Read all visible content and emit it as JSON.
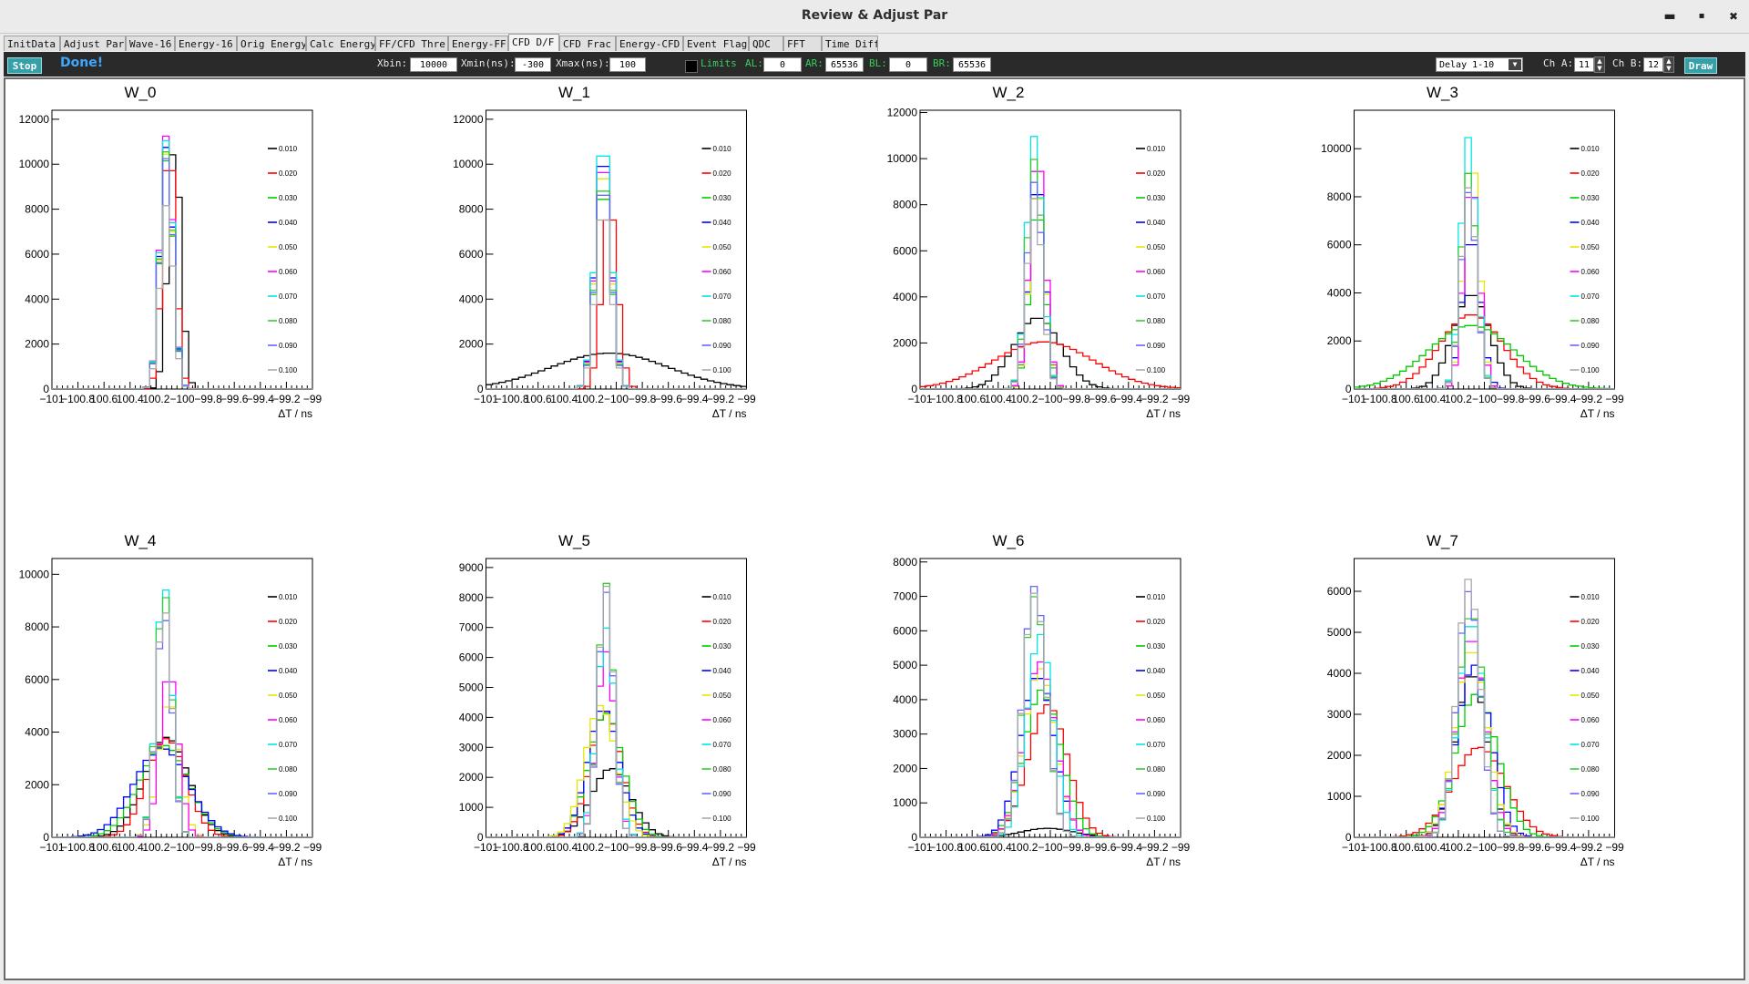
{
  "window": {
    "title": "Review & Adjust Par",
    "minimize": "▬",
    "maximize": "▪",
    "close": "✖"
  },
  "tabs": [
    {
      "label": "InitData",
      "active": false
    },
    {
      "label": "Adjust Par",
      "active": false
    },
    {
      "label": "Wave-16",
      "active": false
    },
    {
      "label": "Energy-16",
      "active": false
    },
    {
      "label": "Orig Energy",
      "active": false
    },
    {
      "label": "Calc Energy",
      "active": false
    },
    {
      "label": "FF/CFD Thre",
      "active": false
    },
    {
      "label": "Energy-FF",
      "active": false
    },
    {
      "label": "CFD D/F",
      "active": true
    },
    {
      "label": "CFD Frac",
      "active": false
    },
    {
      "label": "Energy-CFD",
      "active": false
    },
    {
      "label": "Event Flag",
      "active": false
    },
    {
      "label": "QDC",
      "active": false
    },
    {
      "label": "FFT",
      "active": false
    },
    {
      "label": "Time Diff",
      "active": false
    }
  ],
  "toolbar": {
    "stop_label": "Stop",
    "status": "Done!",
    "xbin_label": "Xbin:",
    "xbin_value": "10000",
    "xmin_label": "Xmin(ns):",
    "xmin_value": "-300",
    "xmax_label": "Xmax(ns):",
    "xmax_value": "100",
    "limits_label": "Limits",
    "al_label": "AL:",
    "al_value": "0",
    "ar_label": "AR:",
    "ar_value": "65536",
    "bl_label": "BL:",
    "bl_value": "0",
    "br_label": "BR:",
    "br_value": "65536",
    "delay_value": "Delay 1-10",
    "cha_label": "Ch A:",
    "cha_value": "11",
    "chb_label": "Ch B:",
    "chb_value": "12",
    "draw_label": "Draw"
  },
  "chart_data": {
    "type": "histogram",
    "xlabel": "ΔT / ns",
    "x_ticks": [
      "−101",
      "−100.8",
      "100.6",
      "100.4",
      "100.2",
      "−100",
      "−99.8",
      "−99.6",
      "−99.4",
      "−99.2",
      "−99"
    ],
    "xlim": [
      -101,
      -99
    ],
    "legend_labels": [
      "0.010",
      "0.020",
      "0.030",
      "0.040",
      "0.050",
      "0.060",
      "0.070",
      "0.080",
      "0.090",
      "0.100"
    ],
    "series_colors": [
      "#000000",
      "#ff0000",
      "#00cc00",
      "#0000ff",
      "#e6e600",
      "#ff00ff",
      "#00e6e6",
      "#33cc33",
      "#6666ff",
      "#aaaaaa"
    ],
    "panels": [
      {
        "title": "W_0",
        "ylim": [
          0,
          12400
        ],
        "yticks": [
          0,
          2000,
          4000,
          6000,
          8000,
          10000,
          12000
        ],
        "series": [
          {
            "peak": 10900,
            "center": -100.06,
            "sigma": 0.05
          },
          {
            "peak": 11000,
            "center": -100.1,
            "sigma": 0.05
          },
          {
            "peak": 10200,
            "center": -100.12,
            "sigma": 0.05
          },
          {
            "peak": 10800,
            "center": -100.12,
            "sigma": 0.05
          },
          {
            "peak": 10500,
            "center": -100.12,
            "sigma": 0.05
          },
          {
            "peak": 11300,
            "center": -100.12,
            "sigma": 0.05
          },
          {
            "peak": 11100,
            "center": -100.12,
            "sigma": 0.05
          },
          {
            "peak": 10600,
            "center": -100.12,
            "sigma": 0.05
          },
          {
            "peak": 10300,
            "center": -100.12,
            "sigma": 0.05
          },
          {
            "peak": 8200,
            "center": -100.12,
            "sigma": 0.05
          }
        ]
      },
      {
        "title": "W_1",
        "ylim": [
          0,
          12400
        ],
        "yticks": [
          0,
          2000,
          4000,
          6000,
          8000,
          10000,
          12000
        ],
        "series": [
          {
            "peak": 1600,
            "center": -100.05,
            "sigma": 0.45
          },
          {
            "peak": 8200,
            "center": -100.05,
            "sigma": 0.06
          },
          {
            "peak": 9200,
            "center": -100.1,
            "sigma": 0.06
          },
          {
            "peak": 10800,
            "center": -100.1,
            "sigma": 0.06
          },
          {
            "peak": 10200,
            "center": -100.1,
            "sigma": 0.06
          },
          {
            "peak": 10500,
            "center": -100.1,
            "sigma": 0.06
          },
          {
            "peak": 11300,
            "center": -100.1,
            "sigma": 0.06
          },
          {
            "peak": 9600,
            "center": -100.1,
            "sigma": 0.06
          },
          {
            "peak": 9400,
            "center": -100.1,
            "sigma": 0.06
          },
          {
            "peak": 8200,
            "center": -100.1,
            "sigma": 0.06
          }
        ]
      },
      {
        "title": "W_2",
        "ylim": [
          0,
          12100
        ],
        "yticks": [
          0,
          2000,
          4000,
          6000,
          8000,
          10000,
          12000
        ],
        "series": [
          {
            "peak": 3100,
            "center": -100.1,
            "sigma": 0.18
          },
          {
            "peak": 2050,
            "center": -100.05,
            "sigma": 0.38
          },
          {
            "peak": 8000,
            "center": -100.1,
            "sigma": 0.06
          },
          {
            "peak": 9200,
            "center": -100.1,
            "sigma": 0.06
          },
          {
            "peak": 9000,
            "center": -100.1,
            "sigma": 0.06
          },
          {
            "peak": 10300,
            "center": -100.1,
            "sigma": 0.06
          },
          {
            "peak": 11000,
            "center": -100.12,
            "sigma": 0.06
          },
          {
            "peak": 10000,
            "center": -100.12,
            "sigma": 0.06
          },
          {
            "peak": 9000,
            "center": -100.12,
            "sigma": 0.06
          },
          {
            "peak": 8300,
            "center": -100.12,
            "sigma": 0.06
          }
        ]
      },
      {
        "title": "W_3",
        "ylim": [
          0,
          11600
        ],
        "yticks": [
          0,
          2000,
          4000,
          6000,
          8000,
          10000
        ],
        "series": [
          {
            "peak": 3950,
            "center": -100.1,
            "sigma": 0.14
          },
          {
            "peak": 3100,
            "center": -100.1,
            "sigma": 0.24
          },
          {
            "peak": 2650,
            "center": -100.1,
            "sigma": 0.33
          },
          {
            "peak": 6400,
            "center": -100.1,
            "sigma": 0.07
          },
          {
            "peak": 9800,
            "center": -100.1,
            "sigma": 0.06
          },
          {
            "peak": 8700,
            "center": -100.1,
            "sigma": 0.06
          },
          {
            "peak": 10500,
            "center": -100.12,
            "sigma": 0.06
          },
          {
            "peak": 9000,
            "center": -100.12,
            "sigma": 0.06
          },
          {
            "peak": 8200,
            "center": -100.12,
            "sigma": 0.06
          },
          {
            "peak": 8400,
            "center": -100.12,
            "sigma": 0.06
          }
        ]
      },
      {
        "title": "W_4",
        "ylim": [
          0,
          10600
        ],
        "yticks": [
          0,
          2000,
          4000,
          6000,
          8000,
          10000
        ],
        "series": [
          {
            "peak": 3800,
            "center": -100.12,
            "sigma": 0.17
          },
          {
            "peak": 3750,
            "center": -100.12,
            "sigma": 0.15
          },
          {
            "peak": 3500,
            "center": -100.14,
            "sigma": 0.19
          },
          {
            "peak": 3400,
            "center": -100.16,
            "sigma": 0.21
          },
          {
            "peak": 5200,
            "center": -100.1,
            "sigma": 0.08
          },
          {
            "peak": 6300,
            "center": -100.1,
            "sigma": 0.07
          },
          {
            "peak": 9700,
            "center": -100.14,
            "sigma": 0.06
          },
          {
            "peak": 9400,
            "center": -100.14,
            "sigma": 0.06
          },
          {
            "peak": 8500,
            "center": -100.14,
            "sigma": 0.06
          },
          {
            "peak": 8800,
            "center": -100.14,
            "sigma": 0.06
          }
        ]
      },
      {
        "title": "W_5",
        "ylim": [
          0,
          9300
        ],
        "yticks": [
          0,
          1000,
          2000,
          3000,
          4000,
          5000,
          6000,
          7000,
          8000,
          9000
        ],
        "series": [
          {
            "peak": 2300,
            "center": -100.04,
            "sigma": 0.15
          },
          {
            "peak": 4200,
            "center": -100.08,
            "sigma": 0.12
          },
          {
            "peak": 4150,
            "center": -100.08,
            "sigma": 0.13
          },
          {
            "peak": 4300,
            "center": -100.1,
            "sigma": 0.12
          },
          {
            "peak": 4400,
            "center": -100.12,
            "sigma": 0.12
          },
          {
            "peak": 6200,
            "center": -100.08,
            "sigma": 0.07
          },
          {
            "peak": 7000,
            "center": -100.08,
            "sigma": 0.07
          },
          {
            "peak": 8500,
            "center": -100.08,
            "sigma": 0.06
          },
          {
            "peak": 8200,
            "center": -100.08,
            "sigma": 0.06
          },
          {
            "peak": 8400,
            "center": -100.08,
            "sigma": 0.06
          }
        ]
      },
      {
        "title": "W_6",
        "ylim": [
          0,
          8100
        ],
        "yticks": [
          0,
          1000,
          2000,
          3000,
          4000,
          5000,
          6000,
          7000,
          8000
        ],
        "series": [
          {
            "peak": 260,
            "center": -100.02,
            "sigma": 0.2
          },
          {
            "peak": 3850,
            "center": -100.02,
            "sigma": 0.15
          },
          {
            "peak": 4300,
            "center": -100.06,
            "sigma": 0.14
          },
          {
            "peak": 4700,
            "center": -100.1,
            "sigma": 0.13
          },
          {
            "peak": 4900,
            "center": -100.08,
            "sigma": 0.12
          },
          {
            "peak": 5100,
            "center": -100.08,
            "sigma": 0.12
          },
          {
            "peak": 5900,
            "center": -100.08,
            "sigma": 0.1
          },
          {
            "peak": 7000,
            "center": -100.12,
            "sigma": 0.09
          },
          {
            "peak": 7300,
            "center": -100.12,
            "sigma": 0.09
          },
          {
            "peak": 7100,
            "center": -100.12,
            "sigma": 0.09
          }
        ]
      },
      {
        "title": "W_7",
        "ylim": [
          0,
          6800
        ],
        "yticks": [
          0,
          1000,
          2000,
          3000,
          4000,
          5000,
          6000
        ],
        "series": [
          {
            "peak": 4000,
            "center": -100.1,
            "sigma": 0.12
          },
          {
            "peak": 2200,
            "center": -100.04,
            "sigma": 0.2
          },
          {
            "peak": 3500,
            "center": -100.06,
            "sigma": 0.16
          },
          {
            "peak": 4200,
            "center": -100.08,
            "sigma": 0.13
          },
          {
            "peak": 4600,
            "center": -100.1,
            "sigma": 0.12
          },
          {
            "peak": 4900,
            "center": -100.1,
            "sigma": 0.11
          },
          {
            "peak": 5300,
            "center": -100.1,
            "sigma": 0.1
          },
          {
            "peak": 5500,
            "center": -100.1,
            "sigma": 0.1
          },
          {
            "peak": 6000,
            "center": -100.12,
            "sigma": 0.09
          },
          {
            "peak": 6300,
            "center": -100.12,
            "sigma": 0.09
          }
        ]
      }
    ]
  }
}
